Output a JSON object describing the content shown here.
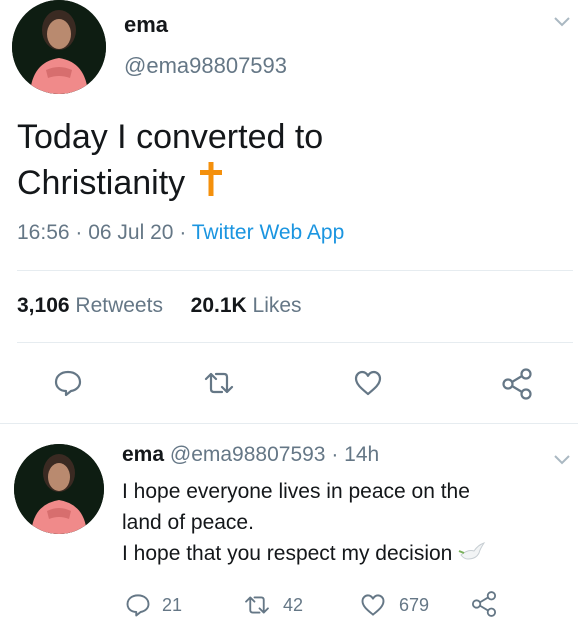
{
  "main_tweet": {
    "author_name": "ema",
    "author_handle": "@ema98807593",
    "text": "Today I converted to Christianity",
    "text_line1": "Today I converted to",
    "text_line2": "Christianity",
    "time": "16:56",
    "date": "06 Jul 20",
    "source": "Twitter Web App",
    "retweets_count": "3,106",
    "retweets_label": "Retweets",
    "likes_count": "20.1K",
    "likes_label": "Likes"
  },
  "reply_tweet": {
    "author_name": "ema",
    "author_handle": "@ema98807593",
    "time_ago": "14h",
    "line1": "I hope everyone lives in peace on the",
    "line2": "land of peace.",
    "line3": "I hope that you respect my decision",
    "reply_count": "21",
    "retweet_count": "42",
    "like_count": "679"
  },
  "icons": [
    "chevron-down-icon",
    "cross-emoji-icon",
    "reply-icon",
    "retweet-icon",
    "like-icon",
    "share-icon",
    "dove-emoji-icon"
  ],
  "colors": {
    "accent": "#1b95e0",
    "cross": "#f4900c",
    "muted": "#657786"
  }
}
